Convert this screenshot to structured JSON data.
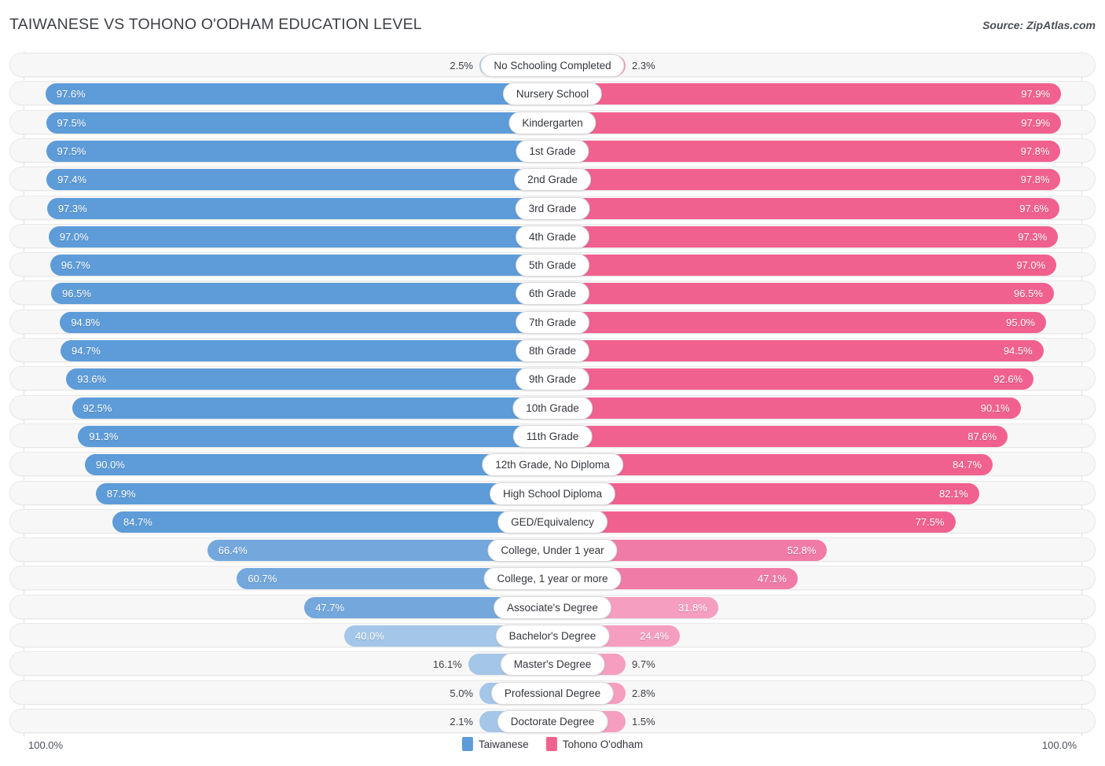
{
  "header": {
    "title": "TAIWANESE VS TOHONO O'ODHAM EDUCATION LEVEL",
    "source": "Source: ZipAtlas.com"
  },
  "axis": {
    "left_max": "100.0%",
    "right_max": "100.0%"
  },
  "legend": {
    "items": [
      {
        "label": "Taiwanese",
        "color": "#5d9cd8"
      },
      {
        "label": "Tohono O'odham",
        "color": "#f1618f"
      }
    ]
  },
  "colors": {
    "blue_strong": "#5d9cd8",
    "blue_mid": "#74a8dd",
    "blue_light": "#a4c6e8",
    "pink_strong": "#f1618f",
    "pink_mid": "#f07ba6",
    "pink_light": "#f59ec0",
    "track": "#f7f7f7",
    "text_dark": "#3c3f45"
  },
  "chart_data": {
    "type": "bar",
    "subtype": "diverging-paired-bar",
    "title": "TAIWANESE VS TOHONO O'ODHAM EDUCATION LEVEL",
    "xlabel": "",
    "ylabel": "",
    "xlim": [
      0,
      100
    ],
    "unit": "%",
    "grid": true,
    "legend_position": "bottom-center",
    "categories": [
      "No Schooling Completed",
      "Nursery School",
      "Kindergarten",
      "1st Grade",
      "2nd Grade",
      "3rd Grade",
      "4th Grade",
      "5th Grade",
      "6th Grade",
      "7th Grade",
      "8th Grade",
      "9th Grade",
      "10th Grade",
      "11th Grade",
      "12th Grade, No Diploma",
      "High School Diploma",
      "GED/Equivalency",
      "College, Under 1 year",
      "College, 1 year or more",
      "Associate's Degree",
      "Bachelor's Degree",
      "Master's Degree",
      "Professional Degree",
      "Doctorate Degree"
    ],
    "series": [
      {
        "name": "Taiwanese",
        "side": "left",
        "color": "#5d9cd8",
        "values": [
          2.5,
          97.6,
          97.5,
          97.5,
          97.4,
          97.3,
          97.0,
          96.7,
          96.5,
          94.8,
          94.7,
          93.6,
          92.5,
          91.3,
          90.0,
          87.9,
          84.7,
          66.4,
          60.7,
          47.7,
          40.0,
          16.1,
          5.0,
          2.1
        ],
        "labels": [
          "2.5%",
          "97.6%",
          "97.5%",
          "97.5%",
          "97.4%",
          "97.3%",
          "97.0%",
          "96.7%",
          "96.5%",
          "94.8%",
          "94.7%",
          "93.6%",
          "92.5%",
          "91.3%",
          "90.0%",
          "87.9%",
          "84.7%",
          "66.4%",
          "60.7%",
          "47.7%",
          "40.0%",
          "16.1%",
          "5.0%",
          "2.1%"
        ]
      },
      {
        "name": "Tohono O'odham",
        "side": "right",
        "color": "#f1618f",
        "values": [
          2.3,
          97.9,
          97.9,
          97.8,
          97.8,
          97.6,
          97.3,
          97.0,
          96.5,
          95.0,
          94.5,
          92.6,
          90.1,
          87.6,
          84.7,
          82.1,
          77.5,
          52.8,
          47.1,
          31.8,
          24.4,
          9.7,
          2.8,
          1.5
        ],
        "labels": [
          "2.3%",
          "97.9%",
          "97.9%",
          "97.8%",
          "97.8%",
          "97.6%",
          "97.3%",
          "97.0%",
          "96.5%",
          "95.0%",
          "94.5%",
          "92.6%",
          "90.1%",
          "87.6%",
          "84.7%",
          "82.1%",
          "77.5%",
          "52.8%",
          "47.1%",
          "31.8%",
          "24.4%",
          "9.7%",
          "2.8%",
          "1.5%"
        ]
      }
    ]
  }
}
